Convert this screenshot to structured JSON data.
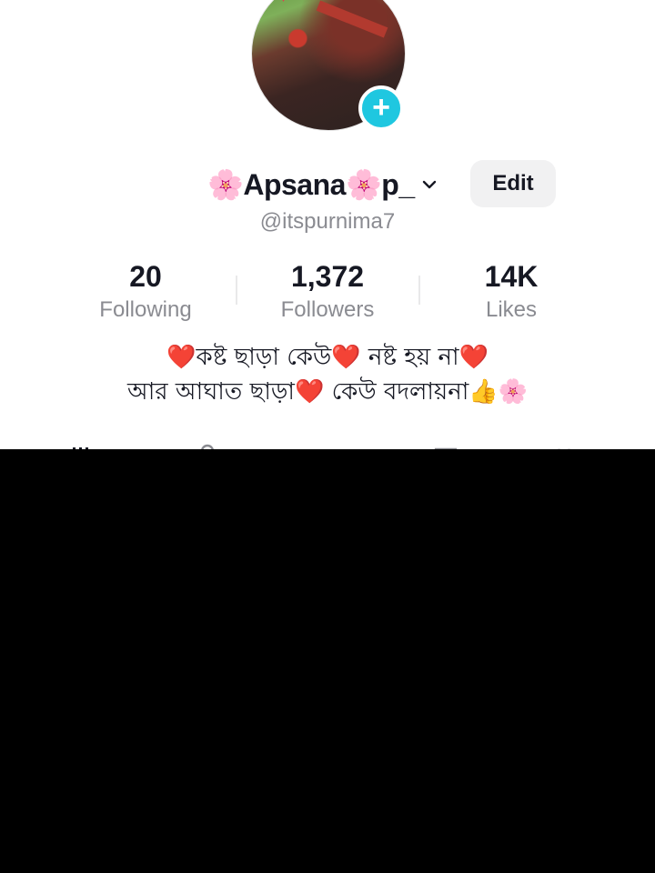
{
  "profile": {
    "display_name": "🌸Apsana🌸p_",
    "handle": "@itspurnima7",
    "edit_label": "Edit",
    "add_icon": "plus-icon",
    "name_dropdown_icon": "chevron-down-icon"
  },
  "stats": {
    "following": {
      "value": "20",
      "label": "Following"
    },
    "followers": {
      "value": "1,372",
      "label": "Followers"
    },
    "likes": {
      "value": "14K",
      "label": "Likes"
    }
  },
  "bio": {
    "line1": "❤️কষ্ট ছাড়া কেউ❤️ নষ্ট হয় না❤️",
    "line2": "আর আঘাত ছাড়া❤️ কেউ বদলায়না👍🌸"
  },
  "tabs": [
    "grid-icon",
    "lock-icon",
    "repost-icon",
    "bookmark-icon",
    "heart-icon"
  ],
  "colors": {
    "accent": "#1fc7e0",
    "text_primary": "#161823",
    "text_secondary": "#8a8b91",
    "button_bg": "#f1f1f2"
  }
}
